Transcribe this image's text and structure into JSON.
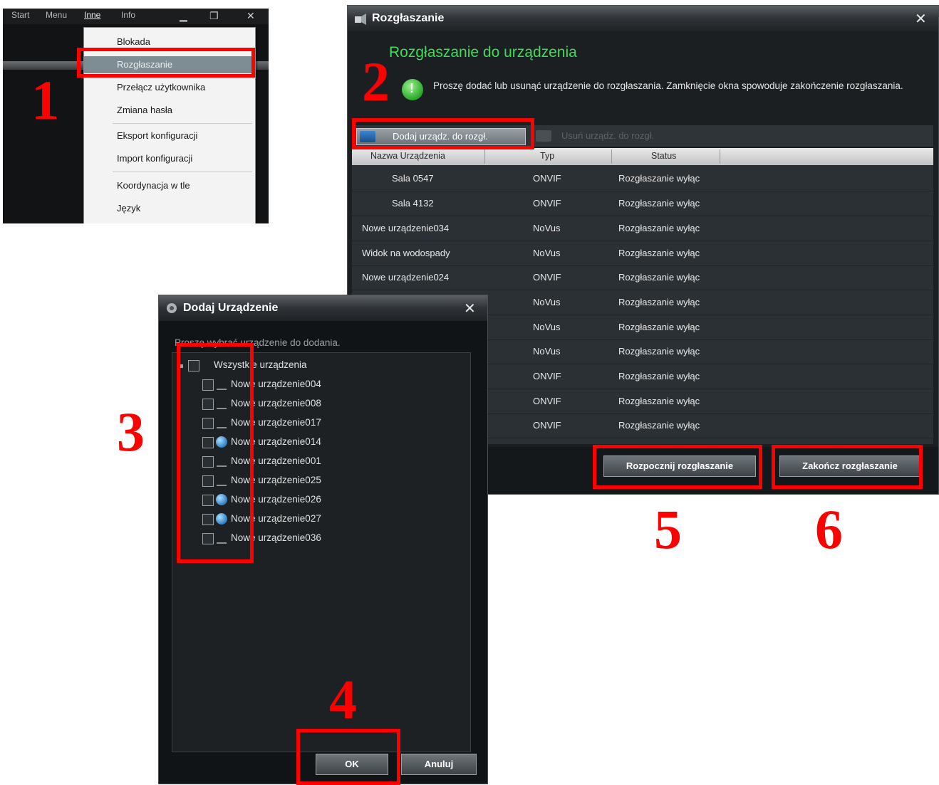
{
  "menu_panel": {
    "menubar": [
      "Start",
      "Menu",
      "Inne",
      "Info"
    ],
    "items": [
      "Blokada",
      "Rozgłaszanie",
      "Przełącz użytkownika",
      "Zmiana hasła",
      "Eksport konfiguracji",
      "Import konfiguracji",
      "Koordynacja w tle",
      "Język"
    ]
  },
  "broadcast_window": {
    "title": "Rozgłaszanie",
    "heading": "Rozgłaszanie do urządzenia",
    "info": "Proszę dodać lub usunąć urządzenie do rozgłaszania. Zamknięcie okna spowoduje zakończenie rozgłaszania.",
    "add_button": "Dodaj urządz. do rozgł.",
    "remove_button": "Usuń urządz. do rozgł.",
    "columns": [
      "Nazwa Urządzenia",
      "Typ",
      "Status"
    ],
    "rows": [
      {
        "name": "Sala 0547",
        "type": "ONVIF",
        "status": "Rozgłaszanie wyłąc"
      },
      {
        "name": "Sala 4132",
        "type": "ONVIF",
        "status": "Rozgłaszanie wyłąc"
      },
      {
        "name": "Nowe urządzenie034",
        "type": "NoVus",
        "status": "Rozgłaszanie wyłąc"
      },
      {
        "name": "Widok na wodospady",
        "type": "NoVus",
        "status": "Rozgłaszanie wyłąc"
      },
      {
        "name": "Nowe urządzenie024",
        "type": "ONVIF",
        "status": "Rozgłaszanie wyłąc"
      },
      {
        "name": "",
        "type": "NoVus",
        "status": "Rozgłaszanie wyłąc"
      },
      {
        "name": "",
        "type": "NoVus",
        "status": "Rozgłaszanie wyłąc"
      },
      {
        "name": "",
        "type": "NoVus",
        "status": "Rozgłaszanie wyłąc"
      },
      {
        "name": "",
        "type": "ONVIF",
        "status": "Rozgłaszanie wyłąc"
      },
      {
        "name": "",
        "type": "ONVIF",
        "status": "Rozgłaszanie wyłąc"
      },
      {
        "name": "",
        "type": "ONVIF",
        "status": "Rozgłaszanie wyłąc"
      }
    ],
    "start_button": "Rozpocznij rozgłaszanie",
    "stop_button": "Zakończ rozgłaszanie"
  },
  "add_window": {
    "title": "Dodaj Urządzenie",
    "description": "Proszę wybrać urządzenie do dodania.",
    "root": "Wszystkie urządzenia",
    "devices": [
      {
        "name": "Nowe urządzenie004",
        "icon": "camera-icon"
      },
      {
        "name": "Nowe urządzenie008",
        "icon": "camera-icon"
      },
      {
        "name": "Nowe urządzenie017",
        "icon": "camera-icon"
      },
      {
        "name": "Nowe urządzenie014",
        "icon": "globe-icon"
      },
      {
        "name": "Nowe urządzenie001",
        "icon": "camera-icon"
      },
      {
        "name": "Nowe urządzenie025",
        "icon": "camera-icon"
      },
      {
        "name": "Nowe urządzenie026",
        "icon": "globe-icon"
      },
      {
        "name": "Nowe urządzenie027",
        "icon": "globe-icon"
      },
      {
        "name": "Nowe urządzenie036",
        "icon": "camera-icon"
      }
    ],
    "ok_button": "OK",
    "cancel_button": "Anuluj"
  },
  "annotations": {
    "n1": "1",
    "n2": "2",
    "n3": "3",
    "n4": "4",
    "n5": "5",
    "n6": "6"
  },
  "colors": {
    "annotation": "#ff0000",
    "heading_green": "#3ddc57"
  }
}
